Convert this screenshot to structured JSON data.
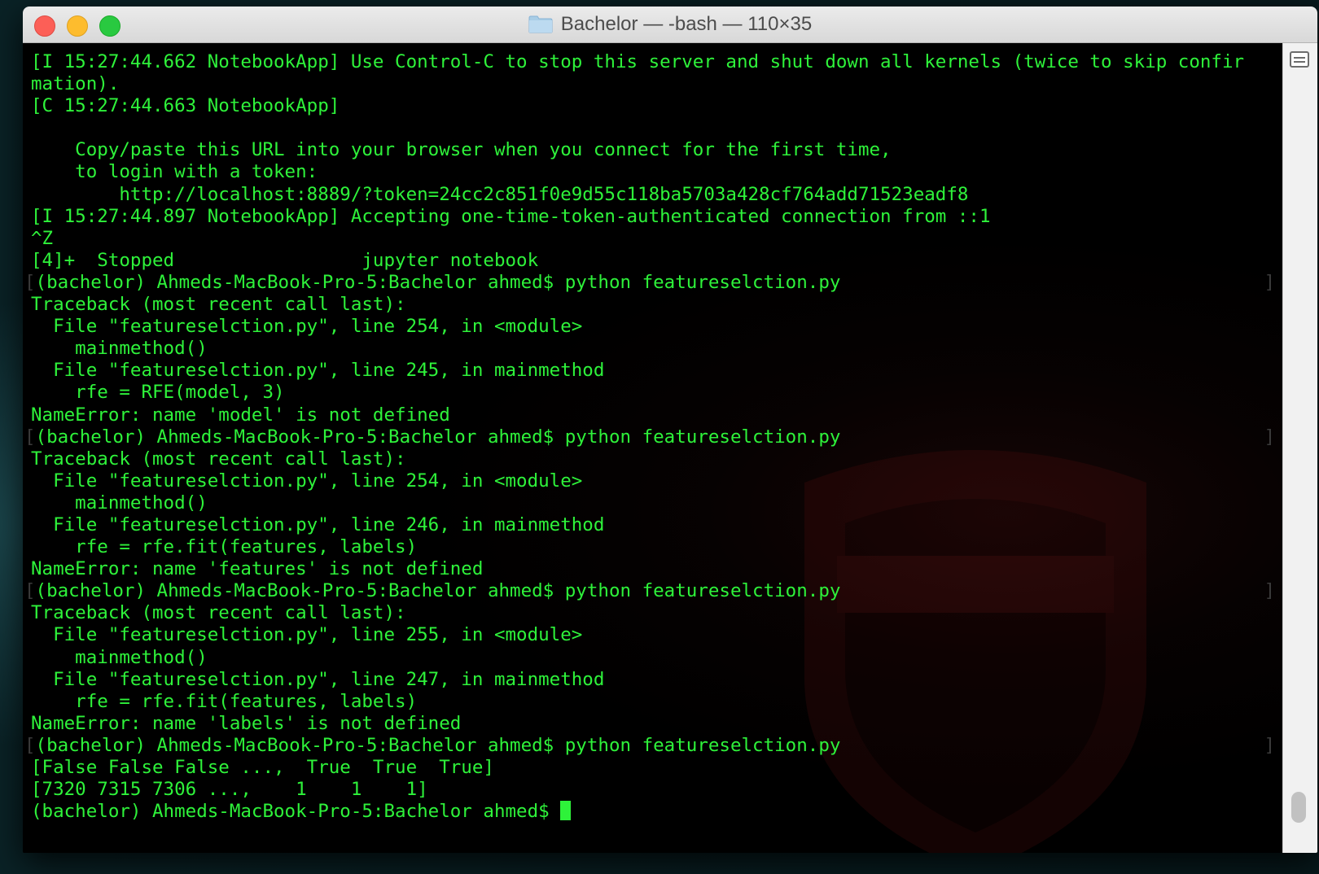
{
  "window": {
    "title": "Bachelor — -bash — 110×35"
  },
  "terminal": {
    "lines": [
      {
        "text": "[I 15:27:44.662 NotebookApp] Use Control-C to stop this server and shut down all kernels (twice to skip confir"
      },
      {
        "text": "mation)."
      },
      {
        "text": "[C 15:27:44.663 NotebookApp]"
      },
      {
        "text": ""
      },
      {
        "text": "    Copy/paste this URL into your browser when you connect for the first time,"
      },
      {
        "text": "    to login with a token:"
      },
      {
        "text": "        http://localhost:8889/?token=24cc2c851f0e9d55c118ba5703a428cf764add71523eadf8"
      },
      {
        "text": "[I 15:27:44.897 NotebookApp] Accepting one-time-token-authenticated connection from ::1"
      },
      {
        "text": "^Z"
      },
      {
        "text": "[4]+  Stopped                 jupyter notebook"
      },
      {
        "text": "(bachelor) Ahmeds-MacBook-Pro-5:Bachelor ahmed$ python featureselction.py",
        "marked": true
      },
      {
        "text": "Traceback (most recent call last):"
      },
      {
        "text": "  File \"featureselction.py\", line 254, in <module>"
      },
      {
        "text": "    mainmethod()"
      },
      {
        "text": "  File \"featureselction.py\", line 245, in mainmethod"
      },
      {
        "text": "    rfe = RFE(model, 3)"
      },
      {
        "text": "NameError: name 'model' is not defined"
      },
      {
        "text": "(bachelor) Ahmeds-MacBook-Pro-5:Bachelor ahmed$ python featureselction.py",
        "marked": true
      },
      {
        "text": "Traceback (most recent call last):"
      },
      {
        "text": "  File \"featureselction.py\", line 254, in <module>"
      },
      {
        "text": "    mainmethod()"
      },
      {
        "text": "  File \"featureselction.py\", line 246, in mainmethod"
      },
      {
        "text": "    rfe = rfe.fit(features, labels)"
      },
      {
        "text": "NameError: name 'features' is not defined"
      },
      {
        "text": "(bachelor) Ahmeds-MacBook-Pro-5:Bachelor ahmed$ python featureselction.py",
        "marked": true
      },
      {
        "text": "Traceback (most recent call last):"
      },
      {
        "text": "  File \"featureselction.py\", line 255, in <module>"
      },
      {
        "text": "    mainmethod()"
      },
      {
        "text": "  File \"featureselction.py\", line 247, in mainmethod"
      },
      {
        "text": "    rfe = rfe.fit(features, labels)"
      },
      {
        "text": "NameError: name 'labels' is not defined"
      },
      {
        "text": "(bachelor) Ahmeds-MacBook-Pro-5:Bachelor ahmed$ python featureselction.py",
        "marked": true
      },
      {
        "text": "[False False False ...,  True  True  True]"
      },
      {
        "text": "[7320 7315 7306 ...,    1    1    1]"
      },
      {
        "text": "(bachelor) Ahmeds-MacBook-Pro-5:Bachelor ahmed$ ",
        "cursor": true
      }
    ]
  },
  "colors": {
    "text": "#2ef23a",
    "background": "#000000",
    "close": "#fc5f57",
    "minimize": "#fdbc2e",
    "zoom": "#29c940"
  },
  "icons": {
    "title_icon": "folder-icon",
    "scrollbar_button": "split-pane-icon"
  }
}
